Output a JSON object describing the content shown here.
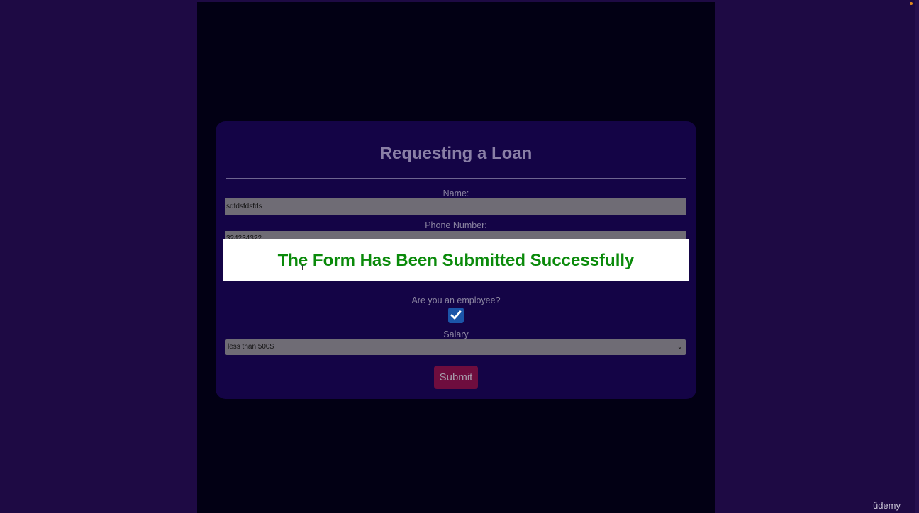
{
  "form": {
    "title": "Requesting a Loan",
    "name_label": "Name:",
    "name_value": "sdfdsfdsfds",
    "phone_label": "Phone Number:",
    "phone_value": "324234322",
    "employee_label": "Are you an employee?",
    "employee_checked": true,
    "salary_label": "Salary",
    "salary_value": "less than 500$",
    "submit_label": "Submit"
  },
  "toast": {
    "message": "The Form Has Been Submitted Successfully"
  },
  "watermark": {
    "text": "ûdemy"
  },
  "colors": {
    "background": "#1e0a44",
    "card": "#140446",
    "toast_text": "#0a8a0a",
    "submit": "#6e0d3e",
    "checkbox": "#1b55a8"
  }
}
